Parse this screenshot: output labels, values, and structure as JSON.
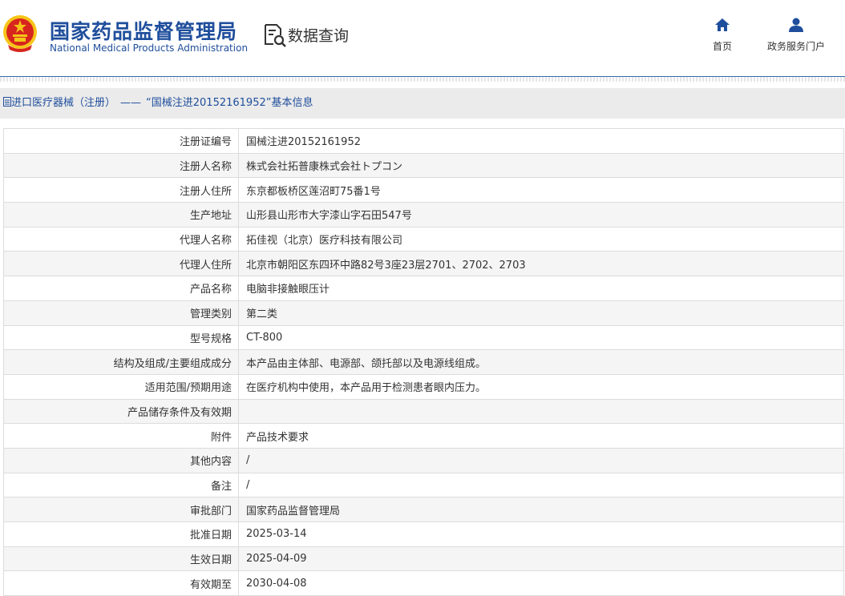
{
  "header": {
    "logo_cn": "国家药品监督管理局",
    "logo_en": "National Medical Products Administration",
    "query_title": "数据查询",
    "nav": [
      {
        "label": "首页",
        "icon": "home-icon"
      },
      {
        "label": "政务服务门户",
        "icon": "user-icon"
      }
    ],
    "colors": {
      "brand": "#1f4e9c",
      "emblem_red": "#d7261e",
      "emblem_gold": "#f5c518"
    }
  },
  "breadcrumb": {
    "section": "进口医疗器械（注册）",
    "separator": "——",
    "page": "“国械注进20152161952”基本信息"
  },
  "table": {
    "rows": [
      {
        "label": "注册证编号",
        "value": "国械注进20152161952"
      },
      {
        "label": "注册人名称",
        "value": "株式会社拓普康株式会社トプコン"
      },
      {
        "label": "注册人住所",
        "value": "东京都板桥区莲沼町75番1号"
      },
      {
        "label": "生产地址",
        "value": "山形县山形市大字漆山字石田547号"
      },
      {
        "label": "代理人名称",
        "value": "拓佳视（北京）医疗科技有限公司"
      },
      {
        "label": "代理人住所",
        "value": "北京市朝阳区东四环中路82号3座23层2701、2702、2703"
      },
      {
        "label": "产品名称",
        "value": "电脑非接触眼压计"
      },
      {
        "label": "管理类别",
        "value": "第二类"
      },
      {
        "label": "型号规格",
        "value": "CT-800"
      },
      {
        "label": "结构及组成/主要组成成分",
        "value": "本产品由主体部、电源部、颌托部以及电源线组成。"
      },
      {
        "label": "适用范围/预期用途",
        "value": "在医疗机构中使用，本产品用于检测患者眼内压力。"
      },
      {
        "label": "产品储存条件及有效期",
        "value": ""
      },
      {
        "label": "附件",
        "value": "产品技术要求"
      },
      {
        "label": "其他内容",
        "value": "/"
      },
      {
        "label": "备注",
        "value": "/"
      },
      {
        "label": "审批部门",
        "value": "国家药品监督管理局"
      },
      {
        "label": "批准日期",
        "value": "2025-03-14"
      },
      {
        "label": "生效日期",
        "value": "2025-04-09"
      },
      {
        "label": "有效期至",
        "value": "2030-04-08"
      }
    ]
  }
}
